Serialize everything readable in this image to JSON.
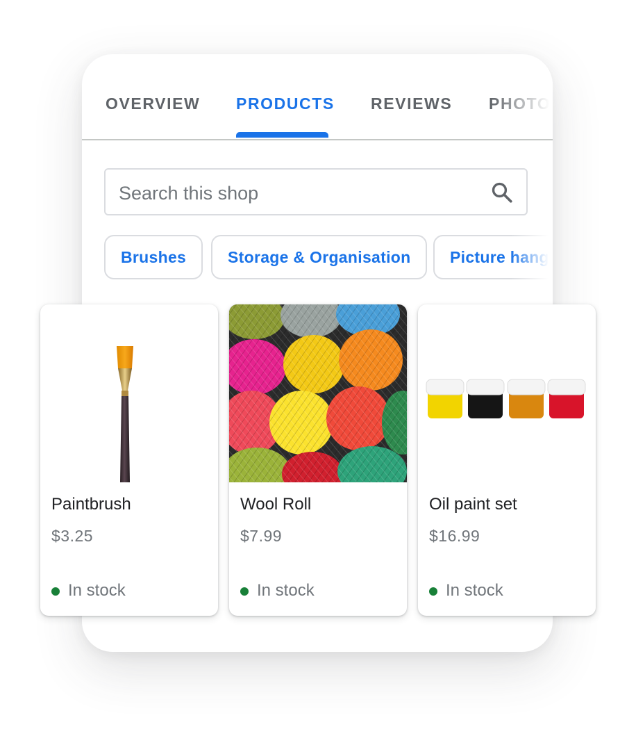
{
  "tabs": [
    {
      "label": "OVERVIEW",
      "active": false
    },
    {
      "label": "PRODUCTS",
      "active": true
    },
    {
      "label": "REVIEWS",
      "active": false
    },
    {
      "label": "PHOTOS",
      "active": false
    }
  ],
  "search": {
    "placeholder": "Search this shop",
    "icon": "search-icon"
  },
  "chips": [
    {
      "label": "Brushes"
    },
    {
      "label": "Storage & Organisation"
    },
    {
      "label": "Picture hangers"
    }
  ],
  "products": [
    {
      "name": "Paintbrush",
      "price": "$3.25",
      "status": "In stock",
      "image": "paintbrush-image"
    },
    {
      "name": "Wool Roll",
      "price": "$7.99",
      "status": "In stock",
      "image": "wool-yarn-image"
    },
    {
      "name": "Oil paint set",
      "price": "$16.99",
      "status": "In stock",
      "image": "paint-jars-image"
    }
  ],
  "colors": {
    "accent": "#1a73e8",
    "tab_inactive": "#5f6368",
    "text_primary": "#202124",
    "text_secondary": "#70757a",
    "in_stock": "#188038",
    "border": "#dadce0"
  }
}
